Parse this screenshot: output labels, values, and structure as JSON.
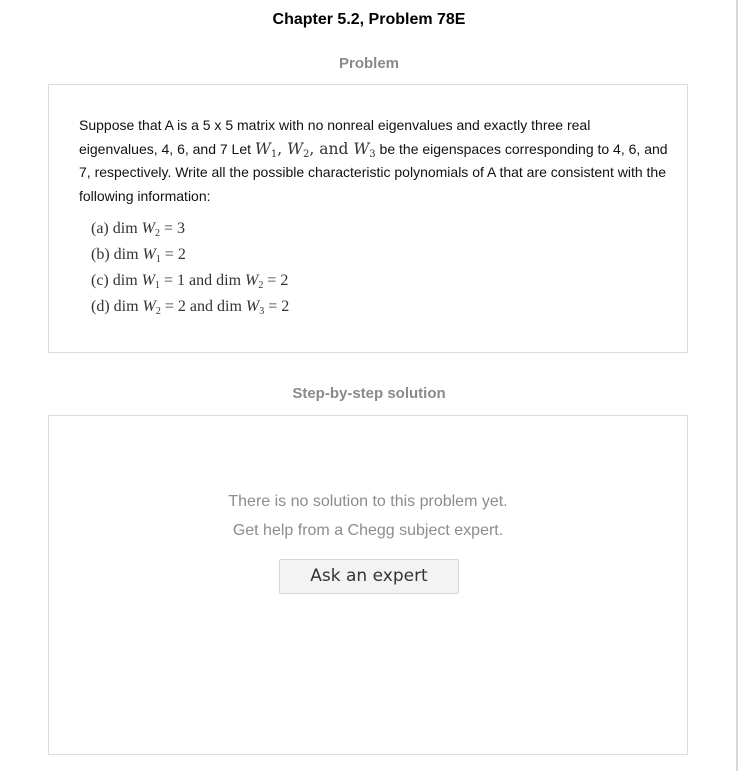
{
  "page_title": "Chapter 5.2, Problem 78E",
  "problem": {
    "heading": "Problem",
    "text_1": "Suppose that A is a 5 x 5 matrix with no nonreal eigenvalues and exactly three real eigenvalues, 4, 6, and 7 Let ",
    "math_W": "W",
    "math_sub1": "1",
    "math_sub2": "2",
    "math_sub3": "3",
    "math_and": "and",
    "text_2": " be the eigenspaces corresponding to 4, 6, and 7, respectively. Write all the possible characteristic polynomials of A that are consistent with the following information:",
    "parts": [
      {
        "label": "(a)",
        "dim": "dim",
        "var": "W",
        "sub": "2",
        "rest": "= 3",
        "and": "",
        "var2": "",
        "sub2": "",
        "rest2": ""
      },
      {
        "label": "(b)",
        "dim": "dim",
        "var": "W",
        "sub": "1",
        "rest": "= 2",
        "and": "",
        "var2": "",
        "sub2": "",
        "rest2": ""
      },
      {
        "label": "(c)",
        "dim": "dim",
        "var": "W",
        "sub": "1",
        "rest": "= 1",
        "and": "and dim",
        "var2": "W",
        "sub2": "2",
        "rest2": "= 2"
      },
      {
        "label": "(d)",
        "dim": "dim",
        "var": "W",
        "sub": "2",
        "rest": "= 2",
        "and": "and dim",
        "var2": "W",
        "sub2": "3",
        "rest2": "= 2"
      }
    ]
  },
  "solution": {
    "heading": "Step-by-step solution",
    "empty_line_1": "There is no solution to this problem yet.",
    "empty_line_2": "Get help from a Chegg subject expert.",
    "ask_button": "Ask an expert"
  }
}
